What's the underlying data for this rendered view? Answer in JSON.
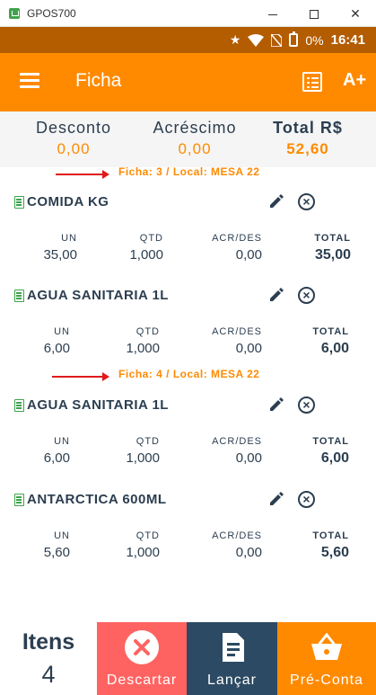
{
  "window": {
    "title": "GPOS700"
  },
  "status": {
    "battery": "0%",
    "time": "16:41"
  },
  "appbar": {
    "title": "Ficha",
    "font_button": "A+"
  },
  "summary": {
    "desconto_label": "Desconto",
    "desconto_value": "0,00",
    "acrescimo_label": "Acréscimo",
    "acrescimo_value": "0,00",
    "total_label": "Total R$",
    "total_value": "52,60"
  },
  "columns": {
    "un": "UN",
    "qtd": "QTD",
    "acr": "ACR/DES",
    "total": "TOTAL"
  },
  "groups": [
    {
      "header": "Ficha: 3 / Local: MESA 22",
      "items": [
        {
          "name": "COMIDA KG",
          "un": "35,00",
          "qtd": "1,000",
          "acr": "0,00",
          "total": "35,00"
        },
        {
          "name": "AGUA SANITARIA 1L",
          "un": "6,00",
          "qtd": "1,000",
          "acr": "0,00",
          "total": "6,00"
        }
      ]
    },
    {
      "header": "Ficha: 4 / Local: MESA 22",
      "items": [
        {
          "name": "AGUA SANITARIA 1L",
          "un": "6,00",
          "qtd": "1,000",
          "acr": "0,00",
          "total": "6,00"
        },
        {
          "name": "ANTARCTICA 600ML",
          "un": "5,60",
          "qtd": "1,000",
          "acr": "0,00",
          "total": "5,60"
        }
      ]
    }
  ],
  "bottom": {
    "itens_label": "Itens",
    "itens_count": "4",
    "descartar": "Descartar",
    "lancar": "Lançar",
    "preconta": "Pré-Conta"
  },
  "colors": {
    "orange": "#ff8a00",
    "navy": "#2c3e50",
    "red": "#ff6361",
    "dark_blue": "#2c4a63",
    "arrow_red": "#e01a1a"
  },
  "icons": [
    "menu-icon",
    "list-icon",
    "receipt-icon",
    "edit-icon",
    "remove-icon",
    "close-circle-icon",
    "document-icon",
    "basket-icon",
    "wifi-icon",
    "star-icon",
    "battery-icon"
  ]
}
